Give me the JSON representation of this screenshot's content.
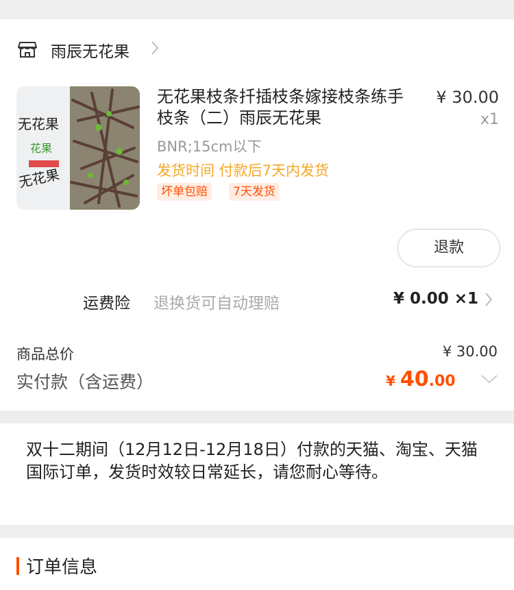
{
  "shop": {
    "name": "雨辰无花果"
  },
  "product": {
    "title": "无花果枝条扦插枝条嫁接枝条练手枝条（二）雨辰无花果",
    "price": "¥ 30.00",
    "quantity": "x1",
    "spec": "BNR;15cm以下",
    "shipping": "发货时间 付款后7天内发货",
    "tags": [
      "坏单包赔",
      "7天发货"
    ],
    "image_text": [
      "无花果",
      "花果",
      "无花果"
    ]
  },
  "refund_button": "退款",
  "insurance": {
    "label": "运费险",
    "desc": "退换货可自动理赔",
    "price": "¥ 0.00 ×1"
  },
  "totals": {
    "goods_label": "商品总价",
    "goods_value": "¥ 30.00",
    "paid_label": "实付款（含运费）",
    "paid_currency": "¥ ",
    "paid_int": "40",
    "paid_dec": ".00"
  },
  "notice": "双十二期间（12月12日-12月18日）付款的天猫、淘宝、天猫国际订单，发货时效较日常延长，请您耐心等待。",
  "order_info": {
    "title": "订单信息"
  },
  "colors": {
    "accent": "#ff5000",
    "shipping": "#f5a623",
    "tag_bg": "#ffede4"
  }
}
